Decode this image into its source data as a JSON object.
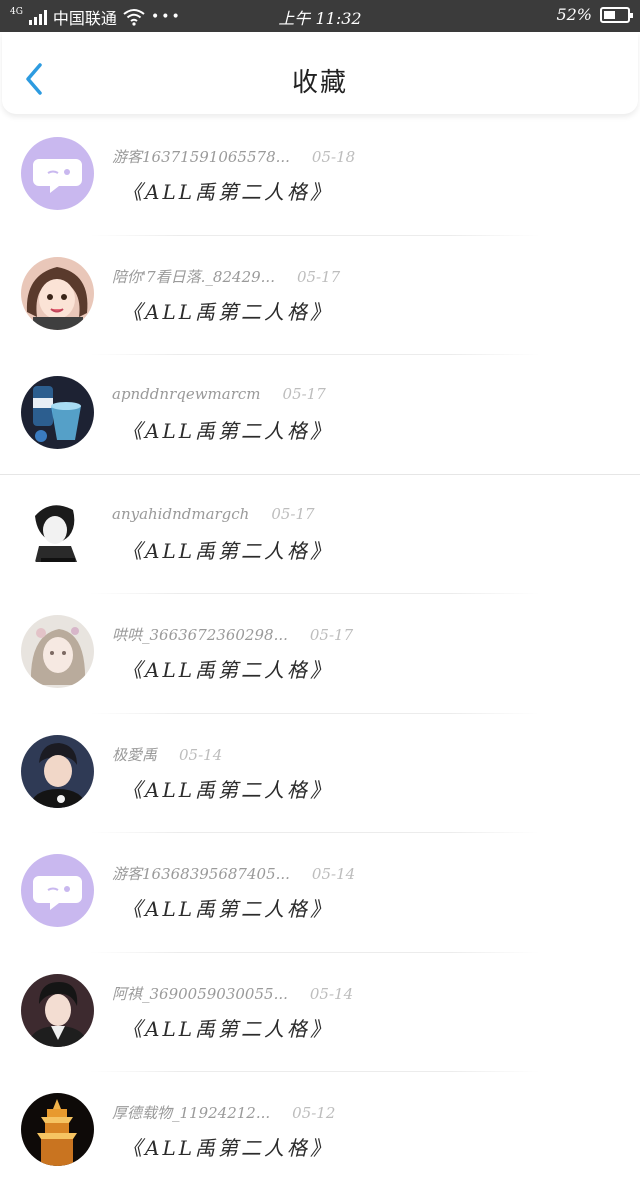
{
  "status_bar": {
    "network": "4G",
    "carrier": "中国联通",
    "dots": "•••",
    "time": "上午 11:32",
    "battery": "52%",
    "battery_level": 0.52
  },
  "header": {
    "title": "收藏",
    "back_icon": "chevron-left-icon",
    "accent": "#2d9be0"
  },
  "favorites": [
    {
      "user": "游客16371591065578...",
      "date": "05-18",
      "title": "《ALL禹第二人格》",
      "avatar": "chat-bubble-default"
    },
    {
      "user": "陪你'7看日落._82429...",
      "date": "05-17",
      "title": "《ALL禹第二人格》",
      "avatar": "anime-girl"
    },
    {
      "user": "apnddnrqewmarcm",
      "date": "05-17",
      "title": "《ALL禹第二人格》",
      "avatar": "drinks-photo"
    },
    {
      "user": "anyahidndmargch",
      "date": "05-17",
      "title": "《ALL禹第二人格》",
      "avatar": "bw-sketch"
    },
    {
      "user": "哄哄_3663672360298...",
      "date": "05-17",
      "title": "《ALL禹第二人格》",
      "avatar": "pastel-girl"
    },
    {
      "user": "极愛禹",
      "date": "05-14",
      "title": "《ALL禹第二人格》",
      "avatar": "young-man-photo"
    },
    {
      "user": "游客16368395687405...",
      "date": "05-14",
      "title": "《ALL禹第二人格》",
      "avatar": "chat-bubble-default"
    },
    {
      "user": "阿祺_3690059030055...",
      "date": "05-14",
      "title": "《ALL禹第二人格》",
      "avatar": "young-man-jacket"
    },
    {
      "user": "厚德载物_11924212...",
      "date": "05-12",
      "title": "《ALL禹第二人格》",
      "avatar": "pagoda-night"
    }
  ],
  "colors": {
    "default_avatar_bg": "#c9b8ef",
    "meta_text": "#9a9a9a"
  }
}
